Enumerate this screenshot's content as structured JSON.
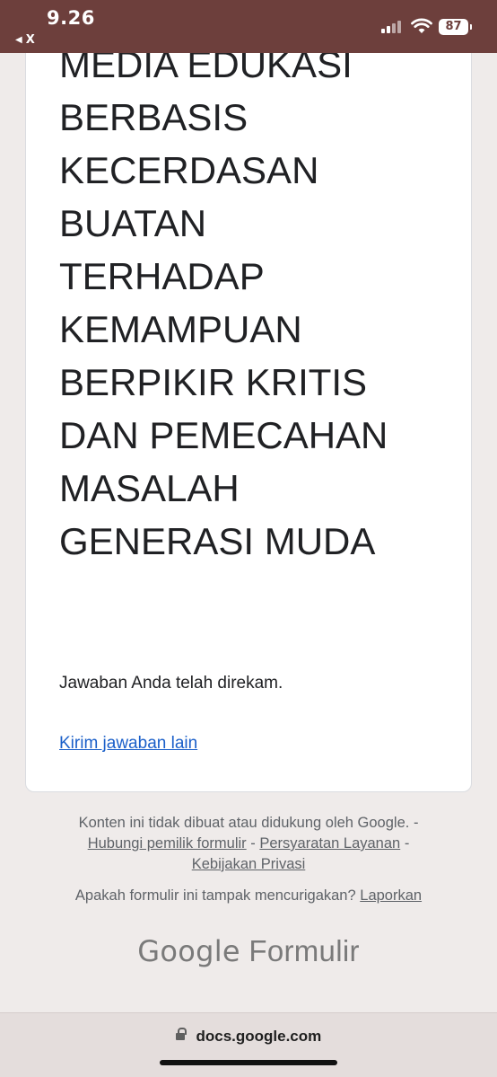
{
  "status_bar": {
    "time": "9.26",
    "back_label": "X",
    "battery": "87"
  },
  "form": {
    "title_lines": [
      "MEDIA EDUKASI",
      "BERBASIS",
      "KECERDASAN",
      "BUATAN",
      "TERHADAP",
      "KEMAMPUAN",
      "BERPIKIR KRITIS",
      "DAN PEMECAHAN",
      "MASALAH",
      "GENERASI MUDA"
    ],
    "confirmation": "Jawaban Anda telah direkam.",
    "another_response_link": "Kirim jawaban lain"
  },
  "footer": {
    "disclaimer": "Konten ini tidak dibuat atau didukung oleh Google.",
    "sep": "-",
    "contact_owner": "Hubungi pemilik formulir",
    "terms": "Persyaratan Layanan",
    "privacy": "Kebijakan Privasi",
    "suspicious_text": "Apakah formulir ini tampak mencurigakan?",
    "report": "Laporkan",
    "brand_google": "Google",
    "brand_forms": "Formulir"
  },
  "url_bar": {
    "domain": "docs.google.com"
  }
}
